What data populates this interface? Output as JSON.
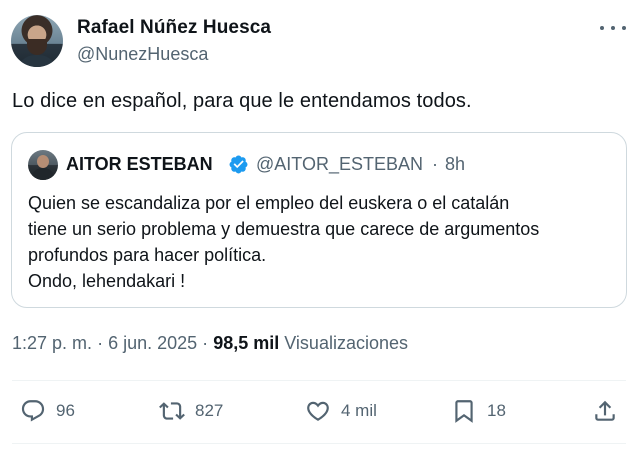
{
  "author": {
    "name": "Rafael Núñez Huesca",
    "handle": "@NunezHuesca"
  },
  "tweet": {
    "text": "Lo dice en español, para que le entendamos todos."
  },
  "quoted": {
    "name": "AITOR ESTEBAN",
    "handle": "@AITOR_ESTEBAN",
    "separator": "·",
    "time": "8h",
    "text": "Quien se escandaliza por el empleo del euskera o el catalán\ntiene un serio problema y demuestra que carece de argumentos\nprofundos para hacer política.\nOndo, lehendakari !",
    "verified_color": "#1d9bf0"
  },
  "meta": {
    "time": "1:27 p. m.",
    "sep1": "·",
    "date": "6 jun. 2025",
    "sep2": "·",
    "views_count": "98,5 mil",
    "views_label": "Visualizaciones"
  },
  "actions": {
    "replies": "96",
    "reposts": "827",
    "likes": "4 mil",
    "bookmarks": "18"
  },
  "colors": {
    "text": "#0f1419",
    "secondary": "#536471",
    "border": "#cfd9de"
  },
  "icons": [
    "more-icon",
    "verified-icon",
    "reply-icon",
    "repost-icon",
    "like-icon",
    "bookmark-icon",
    "share-icon"
  ]
}
